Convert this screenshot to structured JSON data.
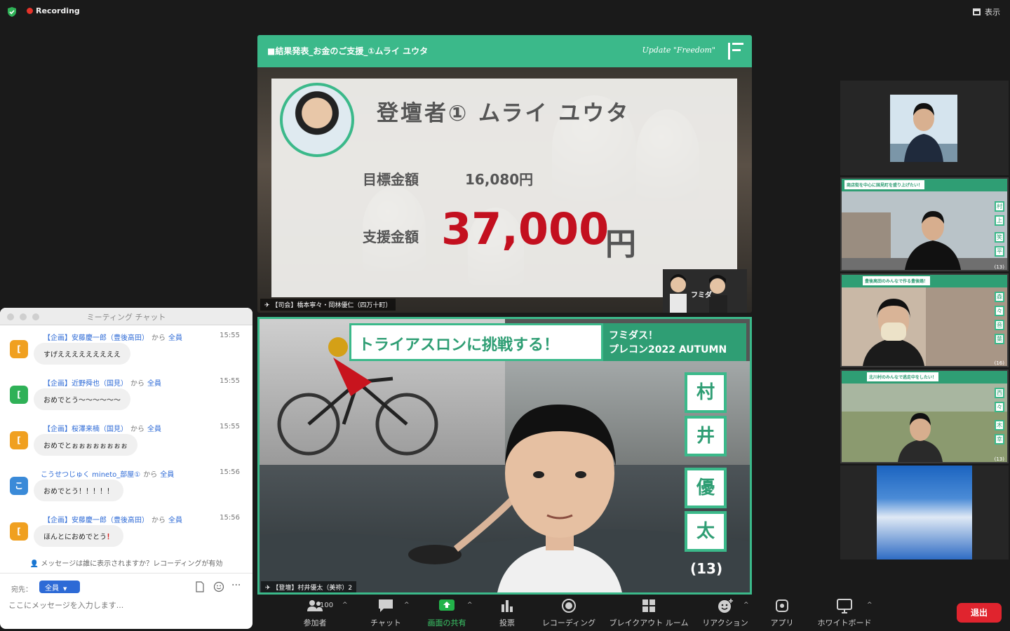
{
  "top_bar": {
    "recording_label": "Recording",
    "view_label": "表示"
  },
  "slide": {
    "header_title": "■結果発表_お金のご支援_①ムライ ユウタ",
    "header_brand": "Update \"Freedom\"",
    "heading": "登壇者① ムライ ユウタ",
    "target_label": "目標金額",
    "target_value": "16,080円",
    "support_label": "支援金額",
    "support_value": "37,000",
    "support_unit": "円",
    "caption": "【司会】橋本寧々・岡林優仁（四万十町）"
  },
  "speaker": {
    "title": "トライアスロンに挑戦する！",
    "brand_line1": "フミダス！",
    "brand_line2": "プレコン2022 AUTUMN",
    "name_chars": [
      "村",
      "井",
      "優",
      "太"
    ],
    "age": "(13)",
    "caption": "【登壇】村井優太（美祢）2"
  },
  "thumbnails": [
    {
      "banner": "",
      "names": [],
      "age": ""
    },
    {
      "banner": "商店街を中心に国見町を盛り上げたい！",
      "names": [
        "村",
        "上",
        "笑",
        "平"
      ],
      "age": "(13)"
    },
    {
      "banner": "豊後高田のみんなで作る豊後踊！",
      "names": [
        "森",
        "々",
        "音",
        "葉"
      ],
      "age": "(16)"
    },
    {
      "banner": "北川村のみんなで逃走中をしたい！",
      "names": [
        "西",
        "々",
        "木",
        "幸"
      ],
      "age": "(13)"
    },
    {
      "banner": "",
      "names": [],
      "age": ""
    }
  ],
  "chat": {
    "title": "ミーティング チャット",
    "messages": [
      {
        "sender": "【企画】安藤慶一郎（豊後高田）",
        "from": "から",
        "to": "全員",
        "time": "15:55",
        "text": "すげえええええええええ",
        "avatar": "[",
        "color": "#f0a020"
      },
      {
        "sender": "【企画】近野舜也（国見）",
        "from": "から",
        "to": "全員",
        "time": "15:55",
        "text": "おめでとう〜〜〜〜〜〜",
        "avatar": "[",
        "color": "#2fb157"
      },
      {
        "sender": "【企画】桜澤来楠（国見）",
        "from": "から",
        "to": "全員",
        "time": "15:55",
        "text": "おめでとぉぉぉぉぉぉぉぉ",
        "avatar": "[",
        "color": "#f0a020"
      },
      {
        "sender": "こうせつじゅく mineto_部屋①",
        "from": "から",
        "to": "全員",
        "time": "15:56",
        "text": "おめでとう！！！！！",
        "avatar": "こ",
        "color": "#3a8ad8"
      },
      {
        "sender": "【企画】安藤慶一郎（豊後高田）",
        "from": "から",
        "to": "全員",
        "time": "15:56",
        "text": "ほんとにおめでとう",
        "avatar": "[",
        "color": "#f0a020"
      }
    ],
    "exclamation": "！",
    "notice": "メッセージは誰に表示されますか？レコーディングが有効",
    "to_label": "宛先：",
    "to_value": "全員",
    "input_placeholder": "ここにメッセージを入力します..."
  },
  "toolbar": {
    "participants_label": "参加者",
    "participants_count": "100",
    "chat_label": "チャット",
    "share_label": "画面の共有",
    "poll_label": "投票",
    "record_label": "レコーディング",
    "breakout_label": "ブレイクアウト ルーム",
    "reaction_label": "リアクション",
    "apps_label": "アプリ",
    "whiteboard_label": "ホワイトボード",
    "end_label": "退出"
  },
  "colors": {
    "accent_green": "#3bb98a",
    "support_red": "#c3101f",
    "chat_blue": "#2d6ad6",
    "end_red": "#e0242e",
    "share_green": "#23b34a"
  }
}
